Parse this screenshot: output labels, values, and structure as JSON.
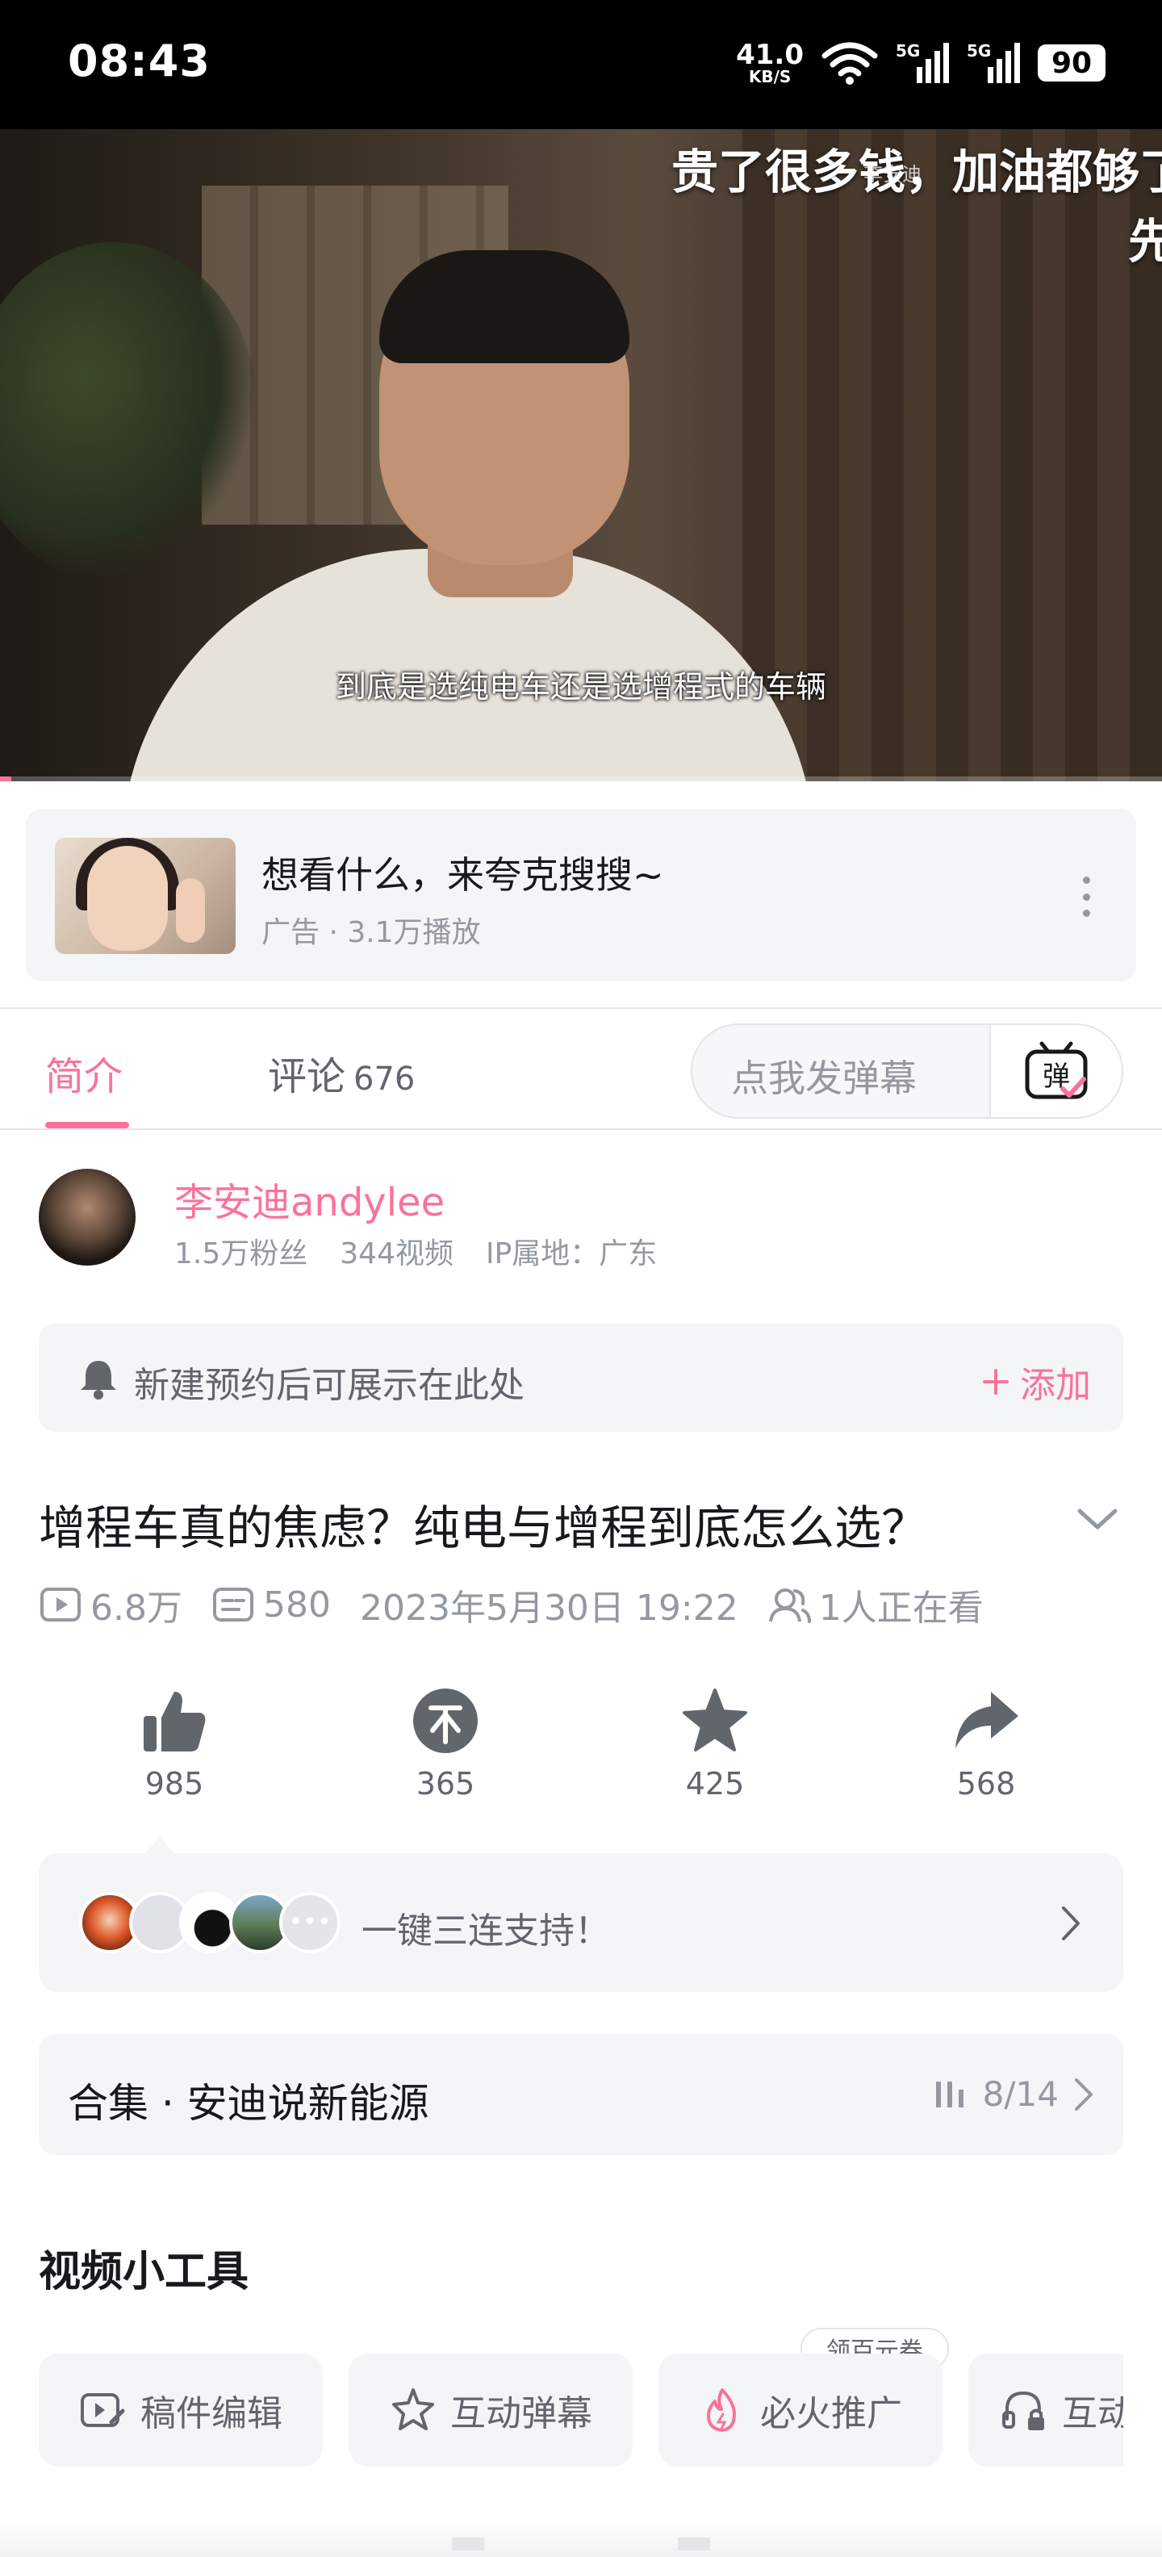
{
  "status_bar": {
    "time": "08:43",
    "net_speed_value": "41.0",
    "net_speed_unit": "KB/S",
    "signal_1": "5G",
    "signal_2": "5G",
    "battery": "90"
  },
  "video": {
    "top_subtitle_line1": "贵了很多钱，加油都够了",
    "top_subtitle_line2": "先",
    "watermark": "李安迪",
    "subtitle": "到底是选纯电车还是选增程式的车辆",
    "progress": 0.01
  },
  "ad": {
    "title": "想看什么，来夸克搜搜~",
    "meta": "广告 · 3.1万播放"
  },
  "tabs": {
    "intro": "简介",
    "comments": "评论",
    "comments_count": "676",
    "danmaku_placeholder": "点我发弹幕",
    "danmaku_icon_char": "弹"
  },
  "uploader": {
    "name": "李安迪andylee",
    "fans": "1.5万粉丝",
    "videos": "344视频",
    "ip": "IP属地：广东"
  },
  "reservation": {
    "text": "新建预约后可展示在此处",
    "add_label": "添加"
  },
  "video_info": {
    "title": "增程车真的焦虑？纯电与增程到底怎么选？",
    "plays": "6.8万",
    "danmaku_count": "580",
    "date": "2023年5月30日 19:22",
    "watching": "1人正在看"
  },
  "actions": {
    "like": "985",
    "coin": "365",
    "favorite": "425",
    "share": "568"
  },
  "triple": {
    "text": "一键三连支持！"
  },
  "collection": {
    "title": "合集 · 安迪说新能源",
    "progress": "8/14"
  },
  "tools": {
    "title": "视频小工具",
    "items": [
      "稿件编辑",
      "互动弹幕",
      "必火推广",
      "互动"
    ],
    "badge": "领百元券"
  },
  "colors": {
    "accent": "#fb7299",
    "text_primary": "#18191c",
    "text_secondary": "#61666d",
    "text_muted": "#9499a0",
    "card_bg": "#f4f5f7"
  }
}
